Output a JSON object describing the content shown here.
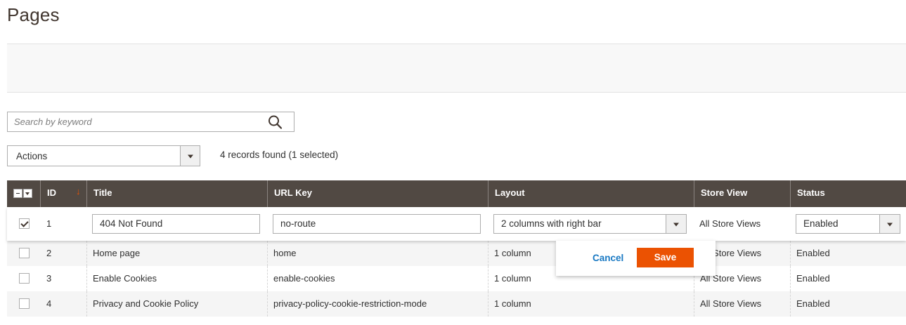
{
  "page": {
    "title": "Pages"
  },
  "search": {
    "placeholder": "Search by keyword"
  },
  "actions": {
    "label": "Actions"
  },
  "records": {
    "text": "4 records found (1 selected)"
  },
  "grid": {
    "columns": [
      "ID",
      "Title",
      "URL Key",
      "Layout",
      "Store View",
      "Status"
    ],
    "rows": [
      {
        "id": "1",
        "title": "404 Not Found",
        "url_key": "no-route",
        "layout": "2 columns with right bar",
        "store_view": "All Store Views",
        "status": "Enabled",
        "checked": true
      },
      {
        "id": "2",
        "title": "Home page",
        "url_key": "home",
        "layout": "1 column",
        "store_view": "All Store Views",
        "status": "Enabled",
        "checked": false
      },
      {
        "id": "3",
        "title": "Enable Cookies",
        "url_key": "enable-cookies",
        "layout": "1 column",
        "store_view": "All Store Views",
        "status": "Enabled",
        "checked": false
      },
      {
        "id": "4",
        "title": "Privacy and Cookie Policy",
        "url_key": "privacy-policy-cookie-restriction-mode",
        "layout": "1 column",
        "store_view": "All Store Views",
        "status": "Enabled",
        "checked": false
      }
    ]
  },
  "inline_edit": {
    "cancel_label": "Cancel",
    "save_label": "Save"
  },
  "colors": {
    "header_bg": "#514943",
    "accent": "#eb5202",
    "link": "#1979c3"
  }
}
